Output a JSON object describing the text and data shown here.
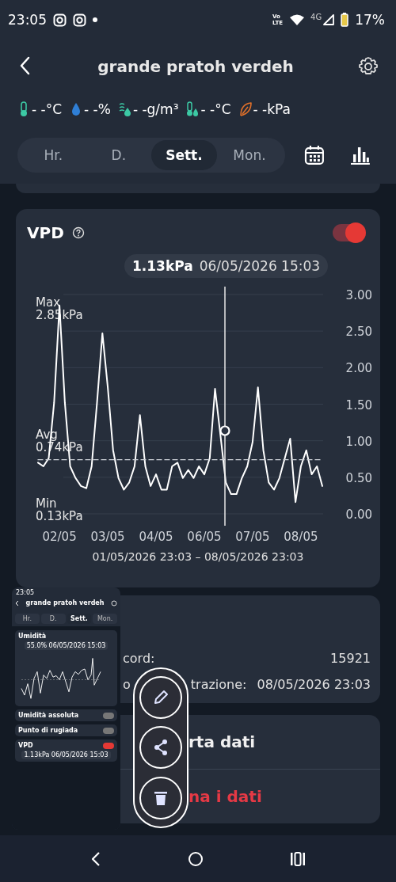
{
  "status_bar": {
    "time": "23:05",
    "volte": "Vo LTE",
    "network": "4G",
    "battery": "17%"
  },
  "header": {
    "title": "grande pratoh verdeh"
  },
  "sensors": [
    {
      "kind": "thermometer",
      "color": "#3cc9a4",
      "text": "- -°C"
    },
    {
      "kind": "drop",
      "color": "#2f7fd6",
      "text": "- -%"
    },
    {
      "kind": "vapor",
      "color": "#3cc9a4",
      "text": "- -g/m³"
    },
    {
      "kind": "dew",
      "color": "#3cc9a4",
      "text": "- -°C"
    },
    {
      "kind": "leaf",
      "color": "#e0702a",
      "text": "- -kPa"
    }
  ],
  "tabs": [
    {
      "label": "Hr.",
      "selected": false
    },
    {
      "label": "D.",
      "selected": false
    },
    {
      "label": "Sett.",
      "selected": true
    },
    {
      "label": "Mon.",
      "selected": false
    }
  ],
  "vpd_card": {
    "title": "VPD",
    "enabled": true,
    "tooltip": {
      "value": "1.13kPa",
      "time": "06/05/2026 15:03"
    },
    "stats": [
      {
        "kind": "max",
        "label": "Max",
        "value": "2.85kPa"
      },
      {
        "kind": "avg",
        "value": "0.74kPa"
      },
      {
        "kind": "min",
        "label": "Min",
        "value": "0.13kPa"
      }
    ],
    "chart_data": {
      "type": "line",
      "grid": true,
      "categories": [
        null,
        null,
        null,
        null,
        "02/05",
        null,
        null,
        null,
        null,
        null,
        null,
        null,
        null,
        "03/05",
        null,
        null,
        null,
        null,
        null,
        null,
        null,
        null,
        "04/05",
        null,
        null,
        null,
        null,
        null,
        null,
        null,
        null,
        "06/05",
        null,
        null,
        null,
        null,
        null,
        null,
        null,
        null,
        "07/05",
        null,
        null,
        null,
        null,
        null,
        null,
        null,
        null,
        "08/05",
        null,
        null,
        null,
        null
      ],
      "series": [
        {
          "color": "#ffffff",
          "values": [
            0.7,
            0.65,
            0.76,
            1.52,
            2.85,
            1.52,
            0.65,
            0.49,
            0.38,
            0.35,
            0.65,
            1.52,
            2.47,
            1.73,
            0.87,
            0.49,
            0.33,
            0.43,
            0.65,
            1.35,
            0.65,
            0.38,
            0.54,
            0.33,
            0.33,
            0.65,
            0.7,
            0.49,
            0.6,
            0.49,
            0.65,
            0.54,
            0.76,
            1.71,
            1.08,
            0.43,
            0.27,
            0.27,
            0.49,
            0.65,
            0.98,
            1.73,
            0.87,
            0.43,
            0.33,
            0.49,
            0.76,
            1.03,
            0.16,
            0.65,
            0.87,
            0.54,
            0.65,
            0.38
          ]
        },
        {
          "name": "Avg",
          "color": "#cfd3d9",
          "line_style": "dashed",
          "values": [
            0.74,
            0.74,
            0.74,
            0.74,
            0.74,
            0.74,
            0.74,
            0.74,
            0.74,
            0.74,
            0.74,
            0.74,
            0.74,
            0.74,
            0.74,
            0.74,
            0.74,
            0.74,
            0.74,
            0.74,
            0.74,
            0.74,
            0.74,
            0.74,
            0.74,
            0.74,
            0.74,
            0.74,
            0.74,
            0.74,
            0.74,
            0.74,
            0.74,
            0.74,
            0.74,
            0.74,
            0.74,
            0.74,
            0.74,
            0.74,
            0.74,
            0.74,
            0.74,
            0.74,
            0.74,
            0.74,
            0.74,
            0.74,
            0.74,
            0.74,
            0.74,
            0.74,
            0.74,
            0.74
          ]
        }
      ],
      "ylim": [
        0,
        3
      ],
      "yticks": [
        {
          "value": 3,
          "label": "3.00"
        },
        {
          "value": 2.5,
          "label": "2.50"
        },
        {
          "value": 2,
          "label": "2.00"
        },
        {
          "value": 1.5,
          "label": "1.50"
        },
        {
          "value": 1,
          "label": "1.00"
        },
        {
          "value": 0.5,
          "label": "0.50"
        },
        {
          "value": 0,
          "label": "0.00"
        }
      ],
      "ylabel": null
    },
    "range": "01/05/2026 23:03 – 08/05/2026 23:03"
  },
  "info_card": {
    "rows": [
      {
        "label": [
          "cord:"
        ],
        "value": "15921"
      },
      {
        "label": [
          "o",
          "trazione:"
        ],
        "value": "08/05/2026 23:03"
      }
    ]
  },
  "actions_card": {
    "items": [
      {
        "kind": "normal",
        "label": "rta dati"
      },
      {
        "kind": "danger",
        "label": "na i dati"
      }
    ]
  },
  "floating_actions": [
    {
      "kind": "edit"
    },
    {
      "kind": "share"
    },
    {
      "kind": "delete"
    }
  ],
  "screenshot_preview": {
    "time": "23:05",
    "title": "grande pratoh verdeh",
    "tabs": [
      {
        "label": "Hr.",
        "selected": false
      },
      {
        "label": "D.",
        "selected": false
      },
      {
        "label": "Sett.",
        "selected": true
      },
      {
        "label": "Mon.",
        "selected": false
      }
    ],
    "cards": [
      {
        "kind": "chart",
        "title": "Umidità",
        "tooltip": "55.0% 06/05/2026 15:03"
      },
      {
        "kind": "toggle",
        "title": "Umidità assoluta",
        "on": false
      },
      {
        "kind": "toggle",
        "title": "Punto di rugiada",
        "on": false
      },
      {
        "kind": "chart",
        "title": "VPD",
        "on": true,
        "tooltip": "1.13kPa 06/05/2026 15:03"
      }
    ]
  }
}
